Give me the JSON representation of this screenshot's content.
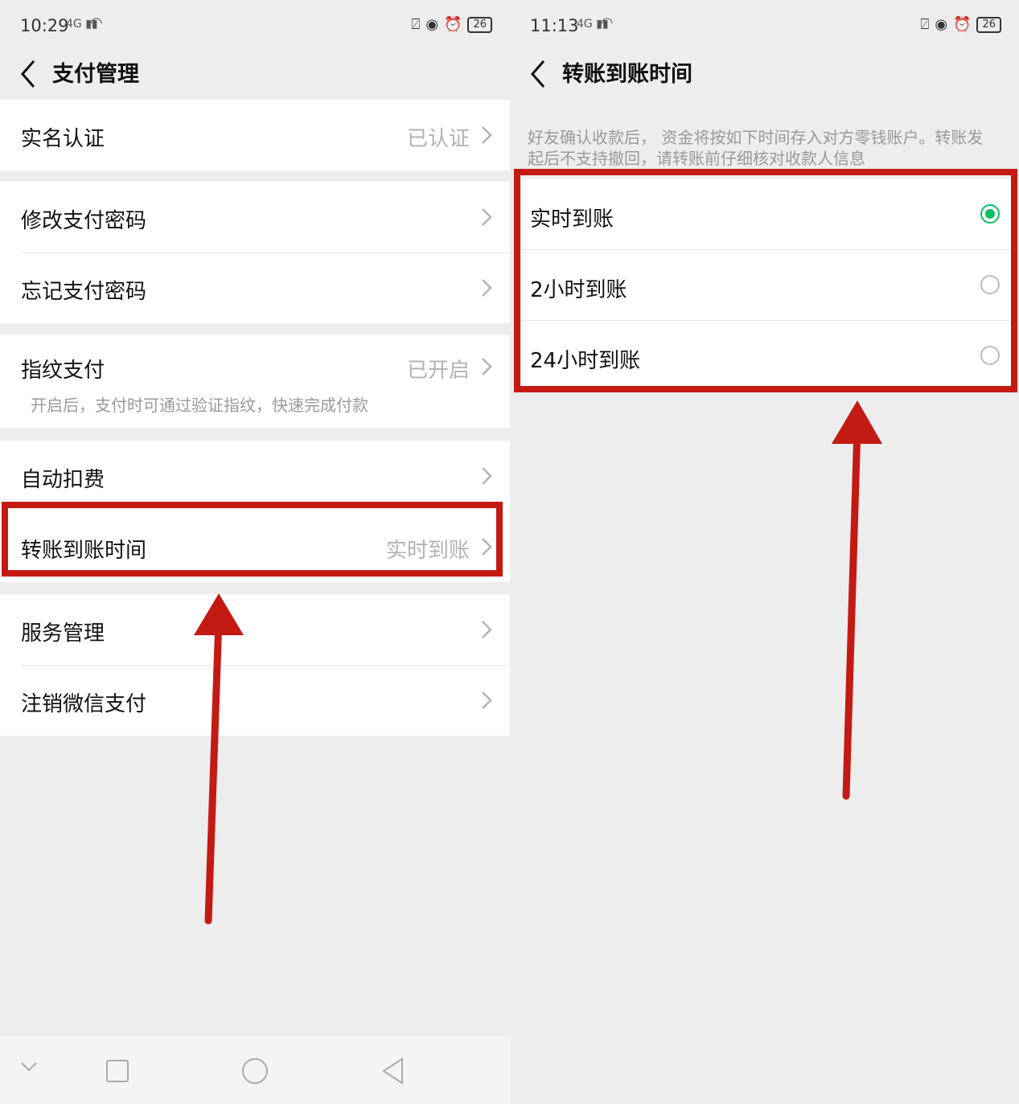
{
  "left": {
    "status": {
      "time": "10:29",
      "signal": "4G",
      "battery": "26"
    },
    "title": "支付管理",
    "rows": [
      {
        "label": "实名认证",
        "value": "已认证"
      },
      {
        "label": "修改支付密码",
        "value": ""
      },
      {
        "label": "忘记支付密码",
        "value": ""
      },
      {
        "label": "指纹支付",
        "value": "已开启",
        "desc": "开启后，支付时可通过验证指纹，快速完成付款"
      },
      {
        "label": "自动扣费",
        "value": ""
      },
      {
        "label": "转账到账时间",
        "value": "实时到账"
      },
      {
        "label": "服务管理",
        "value": ""
      },
      {
        "label": "注销微信支付",
        "value": ""
      }
    ]
  },
  "right": {
    "status": {
      "time": "11:13",
      "signal": "4G",
      "battery": "26"
    },
    "title": "转账到账时间",
    "description": "好友确认收款后， 资金将按如下时间存入对方零钱账户。转账发起后不支持撤回，请转账前仔细核对收款人信息",
    "options": [
      {
        "label": "实时到账",
        "selected": true
      },
      {
        "label": "2小时到账",
        "selected": false
      },
      {
        "label": "24小时到账",
        "selected": false
      }
    ]
  },
  "colors": {
    "accent": "#07c160",
    "highlight": "#c41a14"
  },
  "icons": [
    "back-icon",
    "chevron-right-icon",
    "radio-icon",
    "wifi-icon",
    "battery-icon",
    "alarm-icon"
  ]
}
